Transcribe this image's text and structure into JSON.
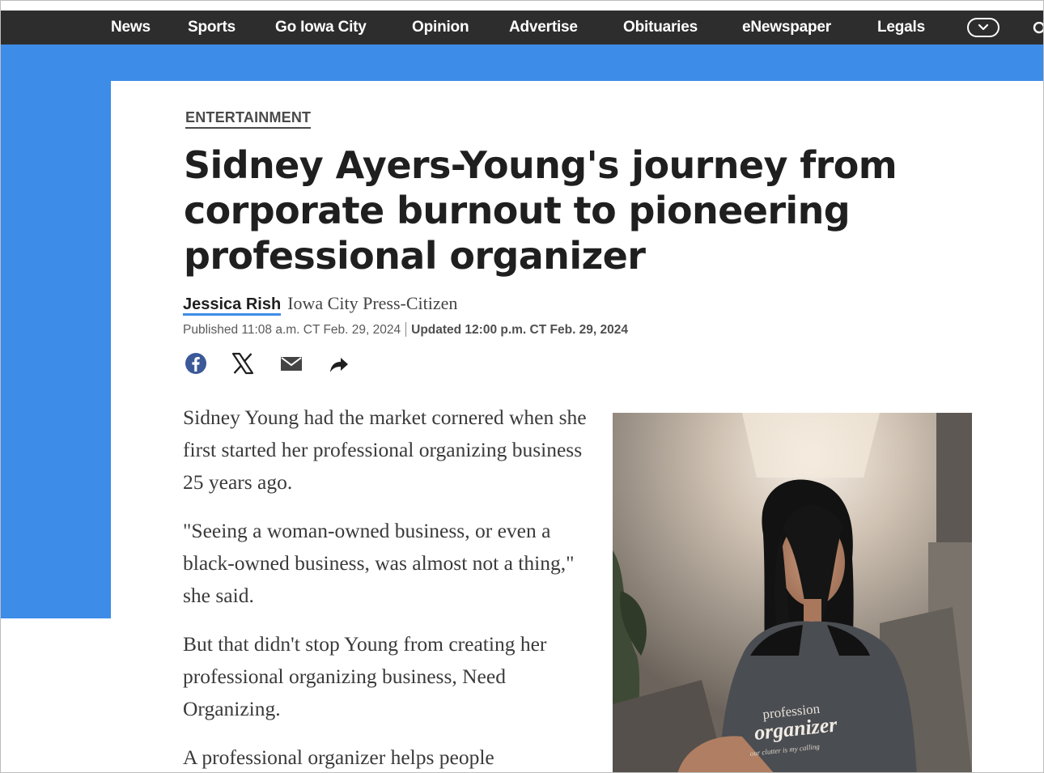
{
  "nav": {
    "items": [
      {
        "label": "News"
      },
      {
        "label": "Sports"
      },
      {
        "label": "Go Iowa City"
      },
      {
        "label": "Opinion"
      },
      {
        "label": "Advertise"
      },
      {
        "label": "Obituaries"
      },
      {
        "label": "eNewspaper"
      },
      {
        "label": "Legals"
      }
    ],
    "more_icon": "chevron-down-icon",
    "search_icon": "search-icon"
  },
  "colors": {
    "nav_bg": "#2d2d2e",
    "accent": "#3d8ce8",
    "text": "#1f1f1f"
  },
  "article": {
    "section": "ENTERTAINMENT",
    "headline": "Sidney Ayers-Young's journey from corporate burnout to pioneering professional organizer",
    "author": "Jessica Rish",
    "outlet": "Iowa City Press-Citizen",
    "published": "Published 11:08 a.m. CT Feb. 29, 2024",
    "updated": "Updated 12:00 p.m. CT Feb. 29, 2024",
    "share_icons": [
      "facebook-icon",
      "x-icon",
      "email-icon",
      "share-icon"
    ],
    "paragraphs": [
      "Sidney Young had the market cornered when she first started her professional organizing business 25 years ago.",
      "\"Seeing a woman-owned business, or even a black-owned business, was almost not a thing,\" she said.",
      "But that didn't stop Young from creating her professional organizing business, Need Organizing.",
      "A professional organizer helps people"
    ],
    "photo": {
      "shirt_text_1": "profession",
      "shirt_text_2": "organizer",
      "shirt_text_3": "our clutter is my calling"
    }
  }
}
